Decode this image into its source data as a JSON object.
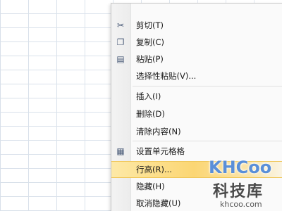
{
  "context_menu": {
    "items": [
      {
        "label": "剪切(T)",
        "icon": "scissors-icon",
        "glyph": "✂"
      },
      {
        "label": "复制(C)",
        "icon": "copy-icon",
        "glyph": "❐"
      },
      {
        "label": "粘贴(P)",
        "icon": "paste-icon",
        "glyph": "▤"
      },
      {
        "label": "选择性粘贴(V)...",
        "icon": "",
        "glyph": ""
      },
      {
        "label": "插入(I)",
        "icon": "",
        "glyph": ""
      },
      {
        "label": "删除(D)",
        "icon": "",
        "glyph": ""
      },
      {
        "label": "清除内容(N)",
        "icon": "",
        "glyph": ""
      },
      {
        "label": "设置单元格格",
        "icon": "format-cells-icon",
        "glyph": "▦"
      },
      {
        "label": "行高(R)...",
        "icon": "",
        "glyph": ""
      },
      {
        "label": "隐藏(H)",
        "icon": "",
        "glyph": ""
      },
      {
        "label": "取消隐藏(U)",
        "icon": "",
        "glyph": ""
      }
    ],
    "highlighted_index": 8
  },
  "watermark": {
    "brand": "KHCoo",
    "name_cn": "科技库",
    "url": "khcoo.com"
  },
  "colors": {
    "highlight": "#fbd674",
    "gridline": "#d6dfe9",
    "watermark_blue": "#5a8fd8"
  }
}
